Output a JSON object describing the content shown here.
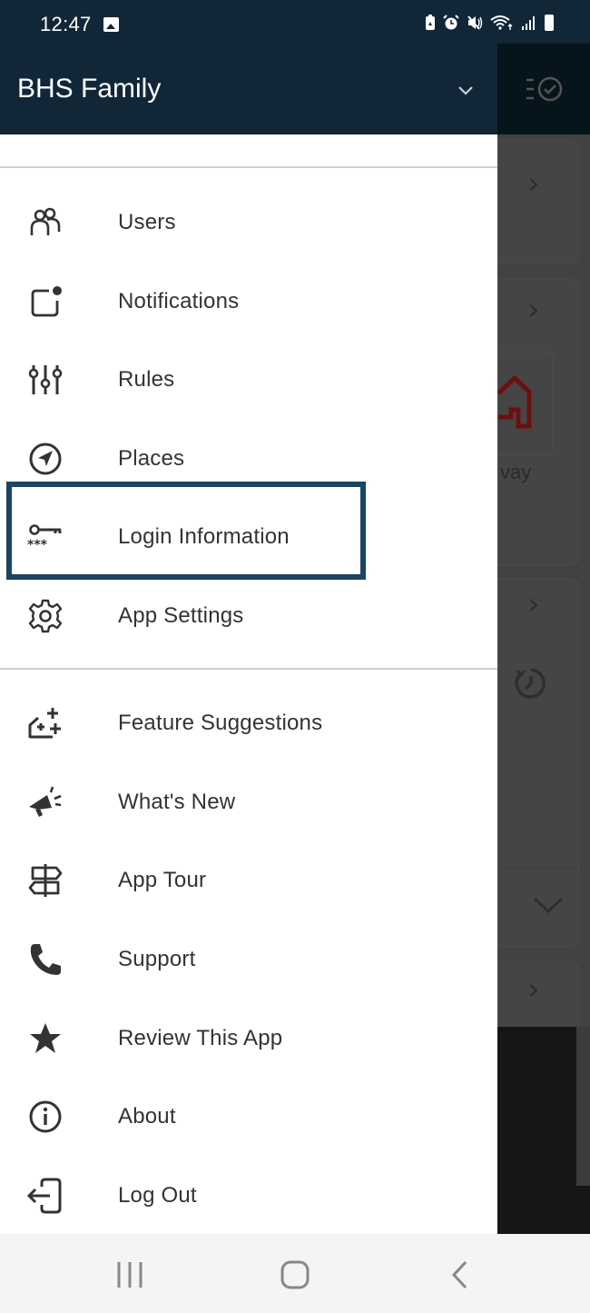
{
  "status_bar": {
    "time": "12:47",
    "icons": [
      "gallery-icon",
      "battery-saver-icon",
      "alarm-icon",
      "mute-icon",
      "wifi-icon",
      "signal-icon",
      "battery-icon"
    ]
  },
  "drawer": {
    "title": "BHS Family",
    "sections": [
      {
        "items": [
          {
            "label": "Users",
            "icon": "users-icon"
          },
          {
            "label": "Notifications",
            "icon": "notification-icon"
          },
          {
            "label": "Rules",
            "icon": "sliders-icon"
          },
          {
            "label": "Places",
            "icon": "navigation-icon"
          },
          {
            "label": "Login Information",
            "icon": "key-password-icon",
            "highlighted": true
          },
          {
            "label": "App Settings",
            "icon": "gear-icon"
          }
        ]
      },
      {
        "items": [
          {
            "label": "Feature Suggestions",
            "icon": "feature-suggestion-icon"
          },
          {
            "label": "What's New",
            "icon": "megaphone-icon"
          },
          {
            "label": "App Tour",
            "icon": "signpost-icon"
          },
          {
            "label": "Support",
            "icon": "phone-icon"
          },
          {
            "label": "Review This App",
            "icon": "star-icon"
          },
          {
            "label": "About",
            "icon": "info-icon"
          },
          {
            "label": "Log Out",
            "icon": "logout-icon"
          }
        ]
      }
    ]
  },
  "background": {
    "partial_text": "vay"
  },
  "colors": {
    "header_bg": "#112737",
    "highlight_border": "#1b4563",
    "text": "#333333",
    "scrim": "#424242"
  }
}
